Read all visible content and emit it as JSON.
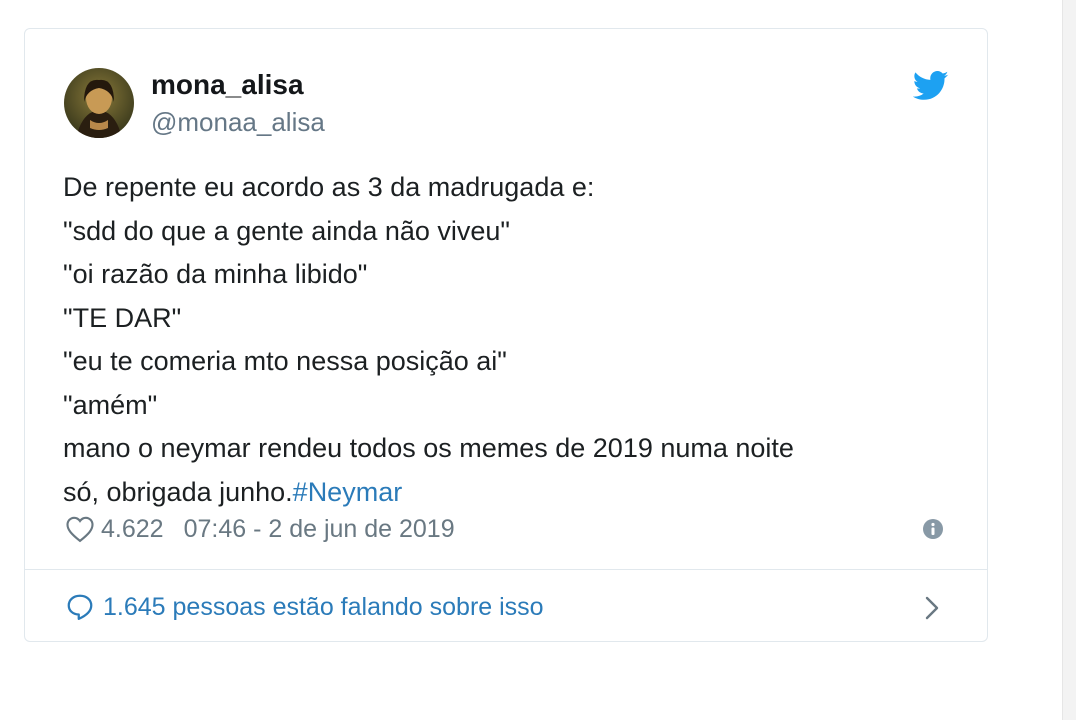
{
  "tweet": {
    "display_name": "mona_alisa",
    "handle": "@monaa_alisa",
    "lines": [
      "De repente eu acordo as 3 da madrugada e:",
      "\"sdd do que a gente ainda não viveu\"",
      "\"oi razão da minha libido\"",
      "\"TE DAR\"",
      "\"eu te comeria mto nessa posição ai\"",
      "\"amém\"",
      "mano o neymar rendeu todos os memes de 2019 numa noite"
    ],
    "last_line_text": "só, obrigada junho.",
    "hashtag": "#Neymar",
    "likes": "4.622",
    "timestamp": "07:46 - 2 de jun de 2019",
    "conversation": "1.645 pessoas estão falando sobre isso"
  },
  "icons": {
    "brand": "twitter-bird-icon",
    "like": "heart-icon",
    "info": "info-icon",
    "conversation": "comment-icon",
    "more": "chevron-right-icon"
  },
  "colors": {
    "twitter_blue": "#1da1f2",
    "link": "#2b7bb9",
    "text": "#1c2022",
    "muted": "#657786",
    "border": "#e1e8ed"
  }
}
